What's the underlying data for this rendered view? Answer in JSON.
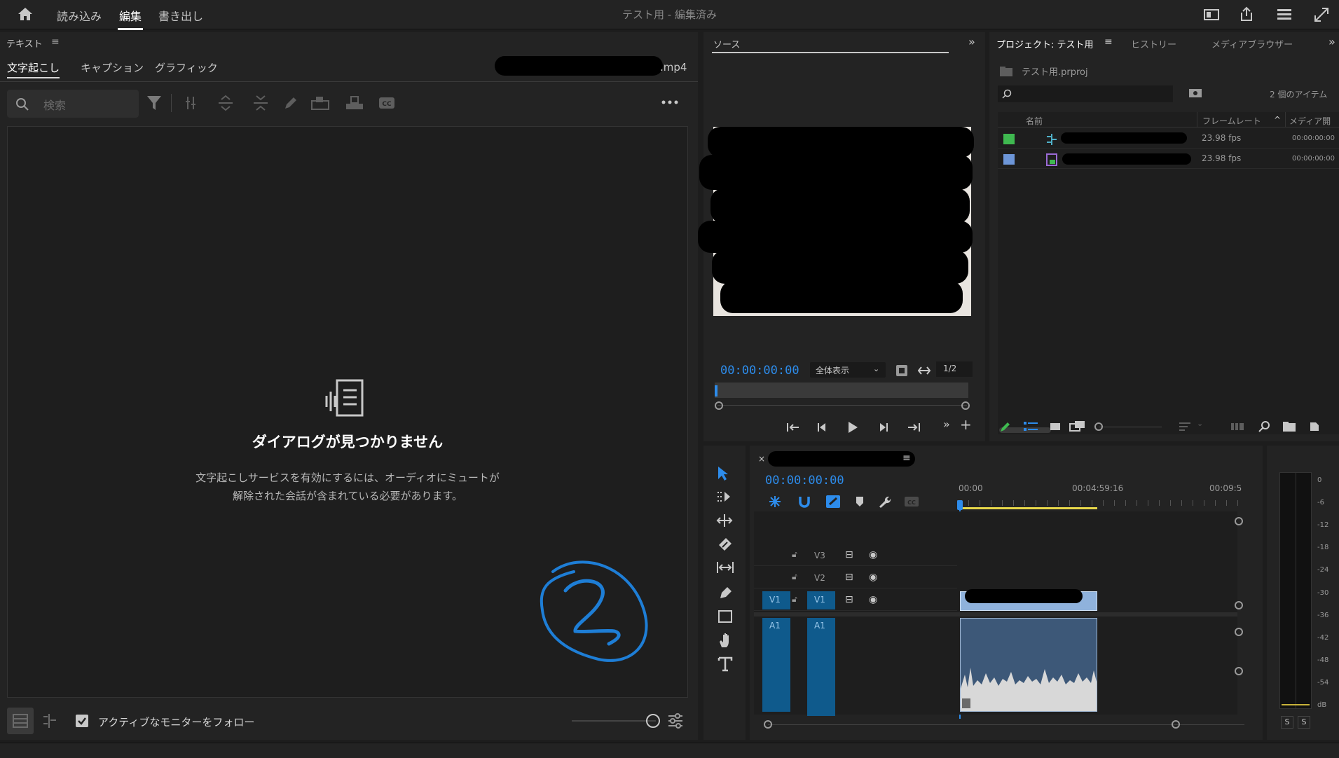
{
  "top": {
    "workspaces": [
      "読み込み",
      "編集",
      "書き出し"
    ],
    "active_workspace": "編集",
    "title": "テスト用 - 編集済み"
  },
  "text_panel": {
    "header": "テキスト",
    "tabs": [
      "文字起こし",
      "キャプション",
      "グラフィック"
    ],
    "filename": ".mp4",
    "search_placeholder": "検索",
    "empty_title": "ダイアログが見つかりません",
    "empty_body_line1": "文字起こしサービスを有効にするには、オーディオにミュートが",
    "empty_body_line2": "解除された会話が含まれている必要があります。",
    "follow_monitor_label": "アクティブなモニターをフォロー",
    "annotation_text": "2"
  },
  "source": {
    "tab": "ソース",
    "timecode": "00:00:00:00",
    "zoom": "全体表示",
    "resolution": "1/2"
  },
  "project": {
    "tabs": [
      "プロジェクト: テスト用",
      "ヒストリー",
      "メディアブラウザー"
    ],
    "file": "テスト用.prproj",
    "item_count": "2 個のアイテム",
    "columns": [
      "名前",
      "フレームレート",
      "メディア開"
    ],
    "rows": [
      {
        "color": "#3fb950",
        "fps": "23.98 fps",
        "media_start": "00:00:00:00"
      },
      {
        "color": "#6d96d8",
        "fps": "23.98 fps",
        "media_start": "00:00:00:00"
      }
    ]
  },
  "timeline": {
    "timecode": "00:00:00:00",
    "ruler": [
      "00:00",
      "00:04:59:16",
      "00:09:5"
    ],
    "tracks": [
      "V3",
      "V2",
      "V1",
      "A1"
    ],
    "source_labels": [
      "V1",
      "A1"
    ]
  },
  "meter": {
    "scale": [
      "0",
      "-6",
      "-12",
      "-18",
      "-24",
      "-30",
      "-36",
      "-42",
      "-48",
      "-54",
      "dB"
    ],
    "solo": [
      "S",
      "S"
    ]
  }
}
